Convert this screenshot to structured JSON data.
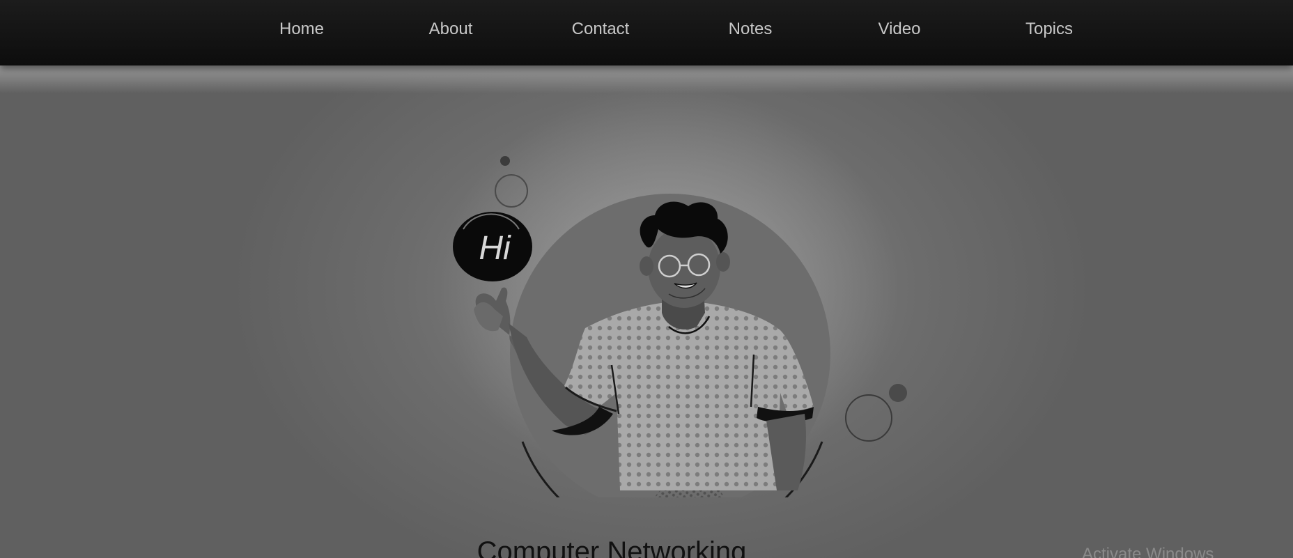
{
  "nav": {
    "items": [
      {
        "label": "Home"
      },
      {
        "label": "About"
      },
      {
        "label": "Contact"
      },
      {
        "label": "Notes"
      },
      {
        "label": "Video"
      },
      {
        "label": "Topics"
      }
    ]
  },
  "hero": {
    "bubble_text": "Hi",
    "illustration_icon": "waving-person-illustration"
  },
  "main": {
    "title": "Computer Networking"
  },
  "system": {
    "watermark": "Activate Windows"
  }
}
